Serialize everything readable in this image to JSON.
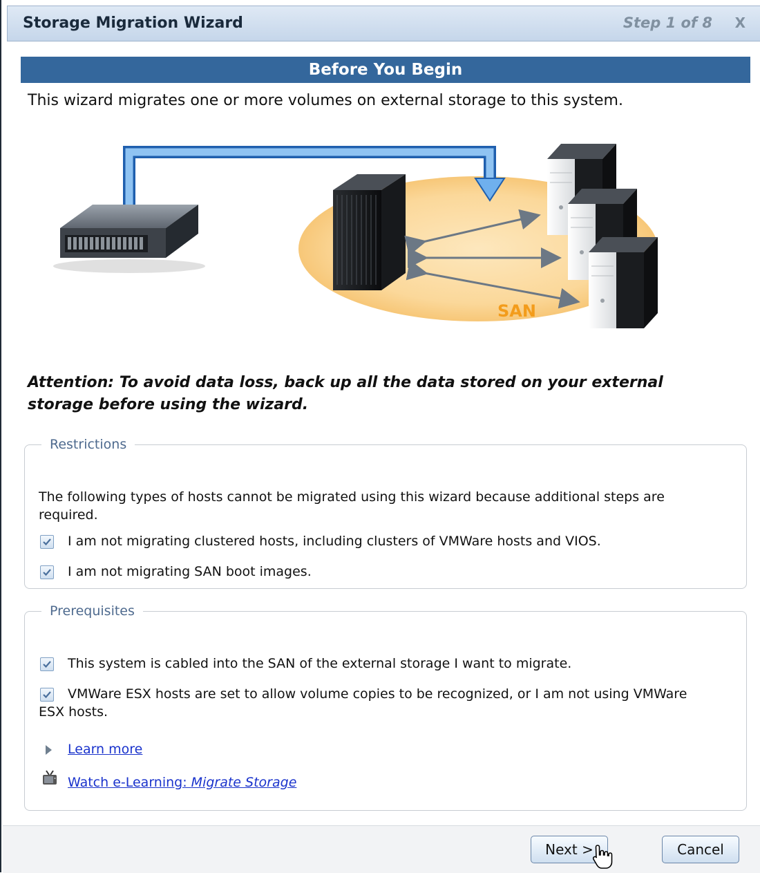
{
  "window": {
    "title": "Storage Migration Wizard",
    "step": "Step 1 of 8",
    "close_label": "X"
  },
  "banner": {
    "title": "Before You Begin"
  },
  "intro": "This wizard migrates one or more volumes on external storage to this system.",
  "diagram": {
    "san_label": "SAN"
  },
  "attention": "Attention: To avoid data loss, back up all the data stored on your external storage before using the wizard.",
  "restrictions": {
    "legend": "Restrictions",
    "description": "The following types of hosts cannot be migrated using this wizard because additional steps are required.",
    "items": [
      {
        "label": "I am not migrating clustered hosts, including clusters of VMWare hosts and VIOS.",
        "checked": true
      },
      {
        "label": "I am not migrating SAN boot images.",
        "checked": true
      }
    ]
  },
  "prerequisites": {
    "legend": "Prerequisites",
    "items": [
      {
        "label": "This system is cabled into the SAN of the external storage I want to migrate.",
        "checked": true
      },
      {
        "label": "VMWare ESX hosts are set to allow volume copies to be recognized, or I am not using VMWare ESX hosts.",
        "checked": true
      }
    ],
    "learn_more": "Learn more",
    "elearning_prefix": "Watch e-Learning: ",
    "elearning_topic": "Migrate Storage"
  },
  "footer": {
    "next_label": "Next >",
    "cancel_label": "Cancel"
  },
  "colors": {
    "banner": "#34679c",
    "san_ellipse": "#fbd89a",
    "arrow_blue": "#3d7fd4",
    "link": "#1a33cc"
  }
}
